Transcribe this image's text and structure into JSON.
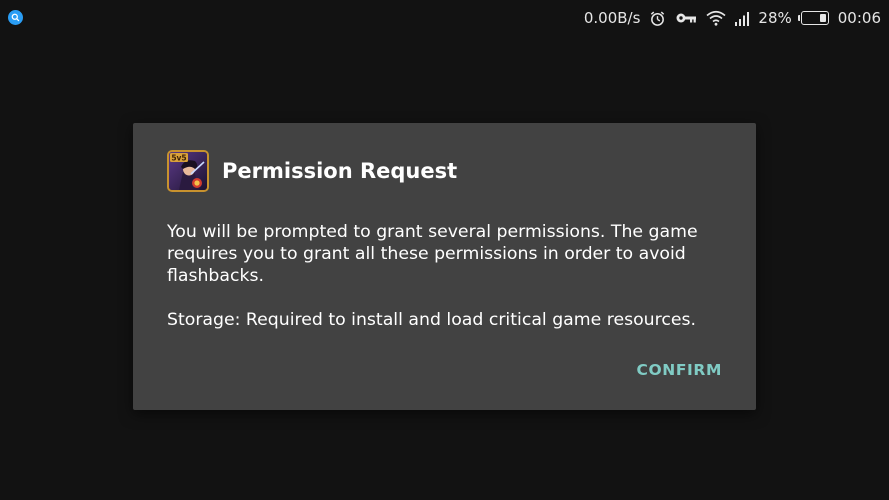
{
  "status_bar": {
    "network_speed": "0.00B/s",
    "battery_percent": "28%",
    "battery_level": 0.28,
    "time": "00:06",
    "icons": [
      "search-notification-icon",
      "alarm-icon",
      "vpn-key-icon",
      "wifi-icon",
      "signal-icon",
      "battery-icon"
    ]
  },
  "dialog": {
    "app_icon": "game-app-icon",
    "app_icon_badge": "5v5",
    "title": "Permission Request",
    "message": "You will be prompted to grant several permissions. The game requires you to grant all these permissions in order to avoid flashbacks.",
    "detail": "Storage: Required to install and load critical game resources.",
    "confirm_label": "CONFIRM"
  },
  "colors": {
    "background": "#121212",
    "dialog_background": "#424242",
    "accent": "#80cbc4",
    "text": "#ffffff"
  }
}
